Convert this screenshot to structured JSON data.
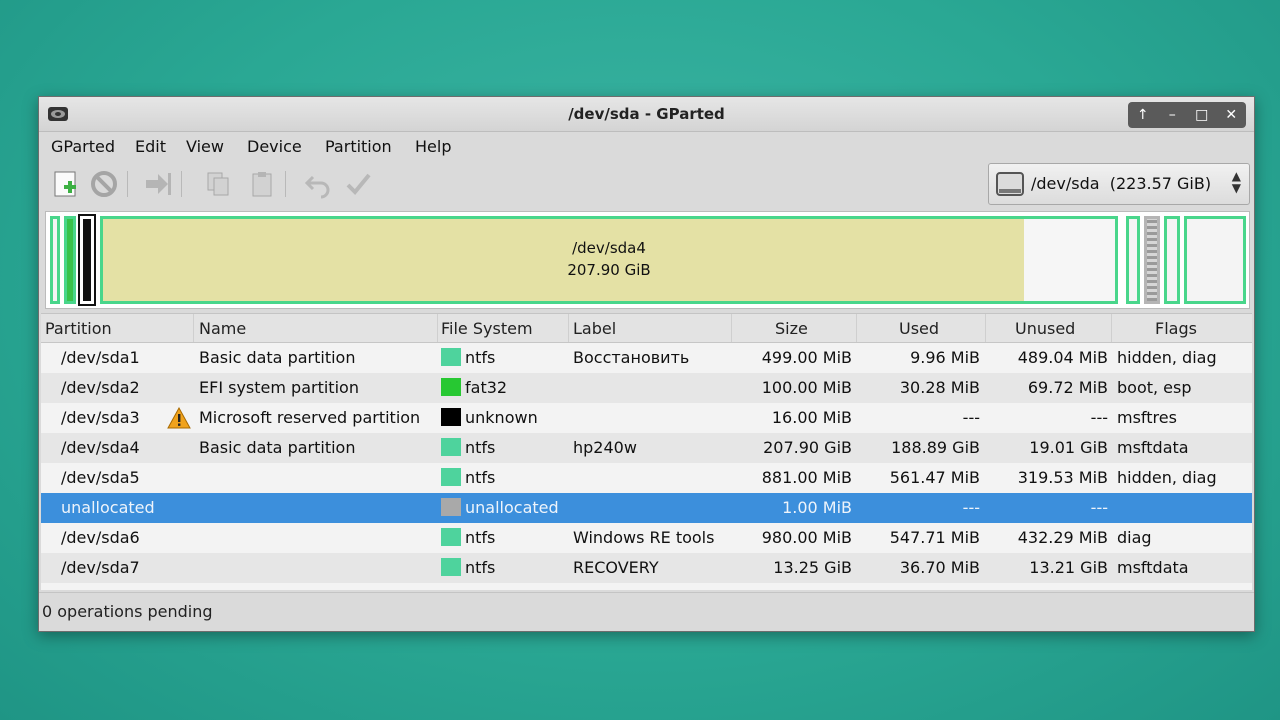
{
  "window": {
    "title": "/dev/sda - GParted"
  },
  "window_buttons": [
    "↑",
    "–",
    "□",
    "✕"
  ],
  "menu": [
    "GParted",
    "Edit",
    "View",
    "Device",
    "Partition",
    "Help"
  ],
  "device": {
    "path": "/dev/sda",
    "size": "(223.57 GiB)"
  },
  "diskmap": {
    "selected_label": "/dev/sda4",
    "selected_size": "207.90 GiB"
  },
  "columns": [
    "Partition",
    "Name",
    "File System",
    "Label",
    "Size",
    "Used",
    "Unused",
    "Flags"
  ],
  "rows": [
    {
      "partition": "/dev/sda1",
      "name": "Basic data partition",
      "fs": "ntfs",
      "label": "Восстановить",
      "size": "499.00 MiB",
      "used": "9.96 MiB",
      "unused": "489.04 MiB",
      "flags": "hidden, diag",
      "fs_color": "#4ed39d"
    },
    {
      "partition": "/dev/sda2",
      "name": "EFI system partition",
      "fs": "fat32",
      "label": "",
      "size": "100.00 MiB",
      "used": "30.28 MiB",
      "unused": "69.72 MiB",
      "flags": "boot, esp",
      "fs_color": "#27c832"
    },
    {
      "partition": "/dev/sda3",
      "name": "Microsoft reserved partition",
      "fs": "unknown",
      "label": "",
      "size": "16.00 MiB",
      "used": "---",
      "unused": "---",
      "flags": "msftres",
      "fs_color": "#000000",
      "warning": true
    },
    {
      "partition": "/dev/sda4",
      "name": "Basic data partition",
      "fs": "ntfs",
      "label": "hp240w",
      "size": "207.90 GiB",
      "used": "188.89 GiB",
      "unused": "19.01 GiB",
      "flags": "msftdata",
      "fs_color": "#4ed39d"
    },
    {
      "partition": "/dev/sda5",
      "name": "",
      "fs": "ntfs",
      "label": "",
      "size": "881.00 MiB",
      "used": "561.47 MiB",
      "unused": "319.53 MiB",
      "flags": "hidden, diag",
      "fs_color": "#4ed39d"
    },
    {
      "partition": "unallocated",
      "name": "",
      "fs": "unallocated",
      "label": "",
      "size": "1.00 MiB",
      "used": "---",
      "unused": "---",
      "flags": "",
      "fs_color": "#a9a9a9",
      "selected": true
    },
    {
      "partition": "/dev/sda6",
      "name": "",
      "fs": "ntfs",
      "label": "Windows RE tools",
      "size": "980.00 MiB",
      "used": "547.71 MiB",
      "unused": "432.29 MiB",
      "flags": "diag",
      "fs_color": "#4ed39d"
    },
    {
      "partition": "/dev/sda7",
      "name": "",
      "fs": "ntfs",
      "label": "RECOVERY",
      "size": "13.25 GiB",
      "used": "36.70 MiB",
      "unused": "13.21 GiB",
      "flags": "msftdata",
      "fs_color": "#4ed39d"
    }
  ],
  "status": "0 operations pending"
}
